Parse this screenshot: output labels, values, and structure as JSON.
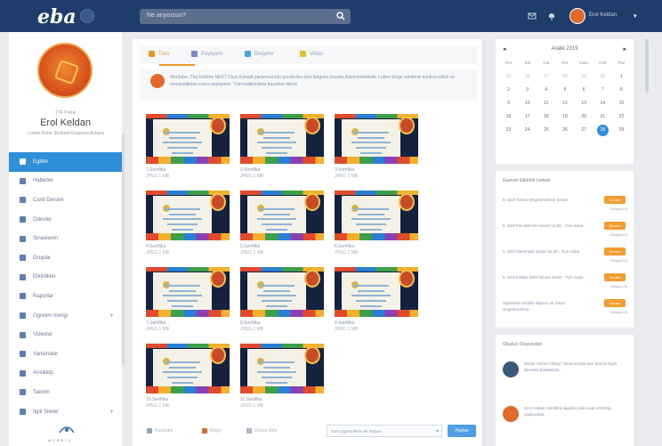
{
  "topbar": {
    "logo": "eba",
    "search_placeholder": "Ne arıyorsun?",
    "user_name": "Erol Keldan"
  },
  "profile": {
    "sub": "TTF Portal",
    "name": "Erol Keldan",
    "desc": "Lorem Dolor Sit Amet Erasmus Ankara"
  },
  "menu": [
    {
      "label": "Egitim",
      "active": true
    },
    {
      "label": "Haberler"
    },
    {
      "label": "Canli Dersler"
    },
    {
      "label": "Odevler"
    },
    {
      "label": "Sinavlarim"
    },
    {
      "label": "Gruplar"
    },
    {
      "label": "Etkinlikler"
    },
    {
      "label": "Raporlar"
    },
    {
      "label": "Ogretim Icerigi"
    },
    {
      "label": "Videolar"
    },
    {
      "label": "Yarismalar"
    },
    {
      "label": "Ansiklop."
    },
    {
      "label": "Takvim"
    },
    {
      "label": "Ilgili Siteler"
    }
  ],
  "footer": {
    "label": "MEBBIS"
  },
  "tabs": [
    {
      "label": "Tüm",
      "color": "#e59a2b"
    },
    {
      "label": "Paylasim",
      "color": "#7a86c8"
    },
    {
      "label": "Belgeler",
      "color": "#4aa3df"
    },
    {
      "label": "Video",
      "color": "#e5c02b"
    }
  ],
  "post": {
    "text": "Merhaba, The Eduline NEXT Days Kanadi yarismasi icin gonderilen tum belgeler burada listelenmektedir. Lutfen belge isimlerini kontrol ediniz ve onaylandiktan sonra paylasiniz. Tüm katilimcilara basarilar dileriz."
  },
  "certificates": [
    {
      "name": "1.Sertifika",
      "size": "JPEG 1 MB"
    },
    {
      "name": "2.Sertifika",
      "size": "JPEG 1 MB"
    },
    {
      "name": "3.Sertifika",
      "size": "JPEG 1 MB"
    },
    {
      "name": "4.Sertifika",
      "size": "JPEG 1 MB"
    },
    {
      "name": "5.Sertifika",
      "size": "JPEG 1 MB"
    },
    {
      "name": "6.Sertifika",
      "size": "JPEG 1 MB"
    },
    {
      "name": "7.Sertifika",
      "size": "JPEG 1 MB"
    },
    {
      "name": "8.Sertifika",
      "size": "JPEG 1 MB"
    },
    {
      "name": "9.Sertifika",
      "size": "JPEG 1 MB"
    },
    {
      "name": "10.Sertifika",
      "size": "JPEG 1 MB"
    },
    {
      "name": "11.Sertifika",
      "size": "JPEG 1 MB"
    }
  ],
  "compose": {
    "items": [
      "Paylasim",
      "Belge",
      "Dosya Ekle"
    ],
    "select": "Tum Ogrencilerim ile Paylas",
    "share": "Paylas"
  },
  "calendar": {
    "month": "Aralik 2019",
    "dows": [
      "Pzt",
      "Sal",
      "Car",
      "Per",
      "Cum",
      "Cmt",
      "Paz"
    ],
    "days": [
      {
        "d": "25",
        "m": true
      },
      {
        "d": "26",
        "m": true
      },
      {
        "d": "27",
        "m": true
      },
      {
        "d": "28",
        "m": true
      },
      {
        "d": "29",
        "m": true
      },
      {
        "d": "30",
        "m": true
      },
      {
        "d": "1"
      },
      {
        "d": "2"
      },
      {
        "d": "3"
      },
      {
        "d": "4"
      },
      {
        "d": "5"
      },
      {
        "d": "6"
      },
      {
        "d": "7"
      },
      {
        "d": "8"
      },
      {
        "d": "9"
      },
      {
        "d": "10"
      },
      {
        "d": "11"
      },
      {
        "d": "12"
      },
      {
        "d": "13"
      },
      {
        "d": "14"
      },
      {
        "d": "15"
      },
      {
        "d": "16"
      },
      {
        "d": "17"
      },
      {
        "d": "18"
      },
      {
        "d": "19"
      },
      {
        "d": "20"
      },
      {
        "d": "21"
      },
      {
        "d": "22"
      },
      {
        "d": "23"
      },
      {
        "d": "24"
      },
      {
        "d": "25"
      },
      {
        "d": "26"
      },
      {
        "d": "27"
      },
      {
        "d": "28",
        "t": true
      },
      {
        "d": "29"
      }
    ]
  },
  "activities": {
    "title": "Guncel Etkinlik Listesi",
    "items": [
      {
        "text": "8. Sinif Turkce Degerlendirme Sinavi",
        "badge": "Devam",
        "link": "Detaya Git"
      },
      {
        "text": "8. Sinif Fen Bilimleri Sinavi 14:00 - Tum Sube",
        "badge": "Devam",
        "link": "Detaya Git"
      },
      {
        "text": "8. Sinif Matematik Sinavi 15:00 - Tum Sube",
        "badge": "Devam",
        "link": "Detaya Git"
      },
      {
        "text": "8. Sinif Inkilap Tarihi Sinavi 16:00 - Tum Sube",
        "badge": "Devam",
        "link": "Detaya Git"
      },
      {
        "text": "Ogretmen Etkinlik Raporu ve Sinav Degerlendirme",
        "badge": "Devam",
        "link": "Detaya Git"
      }
    ]
  },
  "announcements": {
    "title": "Okulun Duyurulari",
    "items": [
      {
        "text": "Mudur Ahmet Yilmaz: Okulumuzda yeni donem kayit islemleri baslamistir.",
        "color": "#3b5a7a"
      },
      {
        "text": "Erol Keldan: Sertifika dagitimi yarin saat 10:00'da yapilacaktir.",
        "color": "#e06a2c"
      }
    ]
  }
}
